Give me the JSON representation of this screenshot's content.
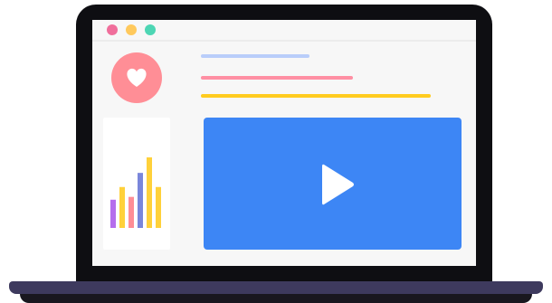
{
  "illustration": {
    "subject": "laptop-with-video-player",
    "colors": {
      "lid": "#0e0e12",
      "screen": "#f7f7f7",
      "base": "#3e3a5e",
      "base_shadow": "#19171f"
    }
  },
  "window_controls": {
    "close_color": "#f06e9b",
    "minimize_color": "#ffc95c",
    "maximize_color": "#4dd6b4"
  },
  "avatar": {
    "icon": "heart-icon",
    "background": "#ff8e96",
    "heart_color": "#ffffff"
  },
  "text_lines": [
    {
      "color": "#b9cdfa"
    },
    {
      "color": "#ff8fa3"
    },
    {
      "color": "#ffcc1f"
    }
  ],
  "mini_chart": {
    "type": "bar",
    "bar_count": 6,
    "values": [
      40,
      58,
      44,
      78,
      100,
      58
    ],
    "colors": [
      "#b56eed",
      "#ffd13a",
      "#ff8e96",
      "#7a86da",
      "#ffd13a",
      "#ffd13a"
    ]
  },
  "video_player": {
    "background": "#3d86f5",
    "play_icon": "play-icon",
    "play_color": "#ffffff"
  }
}
